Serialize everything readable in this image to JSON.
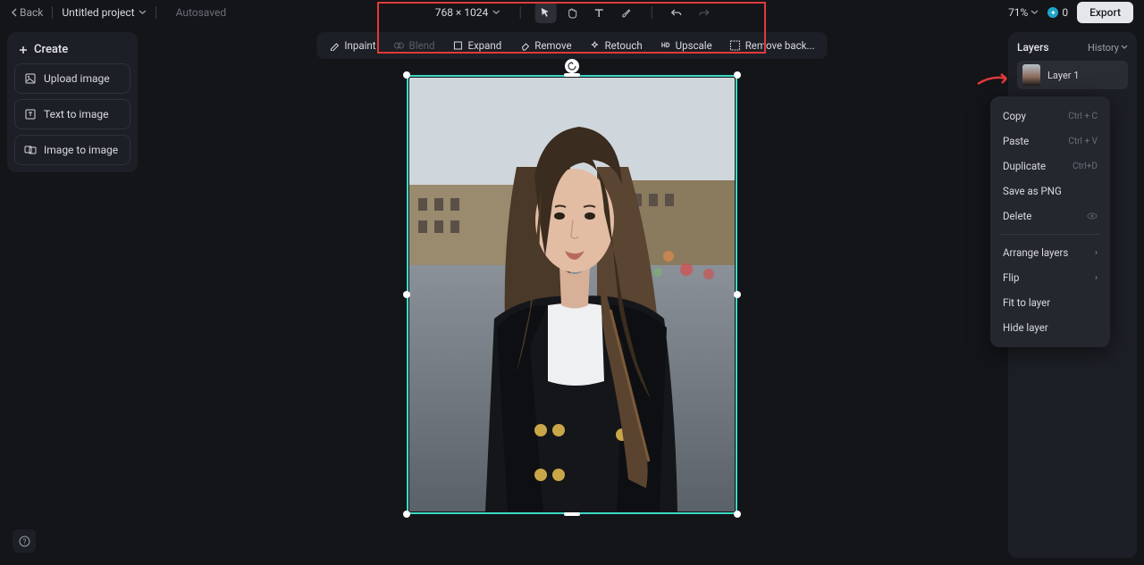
{
  "topbar": {
    "back": "Back",
    "project_name": "Untitled project",
    "autosaved": "Autosaved",
    "dimensions": "768 × 1024",
    "zoom": "71%",
    "credits": "0",
    "export": "Export"
  },
  "actions": {
    "inpaint": "Inpaint",
    "blend": "Blend",
    "expand": "Expand",
    "remove": "Remove",
    "retouch": "Retouch",
    "upscale": "Upscale",
    "remove_bg": "Remove back..."
  },
  "left": {
    "create": "Create",
    "upload": "Upload image",
    "t2i": "Text to image",
    "i2i": "Image to image"
  },
  "right": {
    "layers": "Layers",
    "history": "History",
    "layer1": "Layer 1"
  },
  "ctx": {
    "copy": "Copy",
    "copy_sc": "Ctrl + C",
    "paste": "Paste",
    "paste_sc": "Ctrl + V",
    "duplicate": "Duplicate",
    "dup_sc": "Ctrl+D",
    "save_png": "Save as PNG",
    "delete": "Delete",
    "arrange": "Arrange layers",
    "flip": "Flip",
    "fit": "Fit to layer",
    "hide": "Hide layer"
  },
  "help": "?"
}
